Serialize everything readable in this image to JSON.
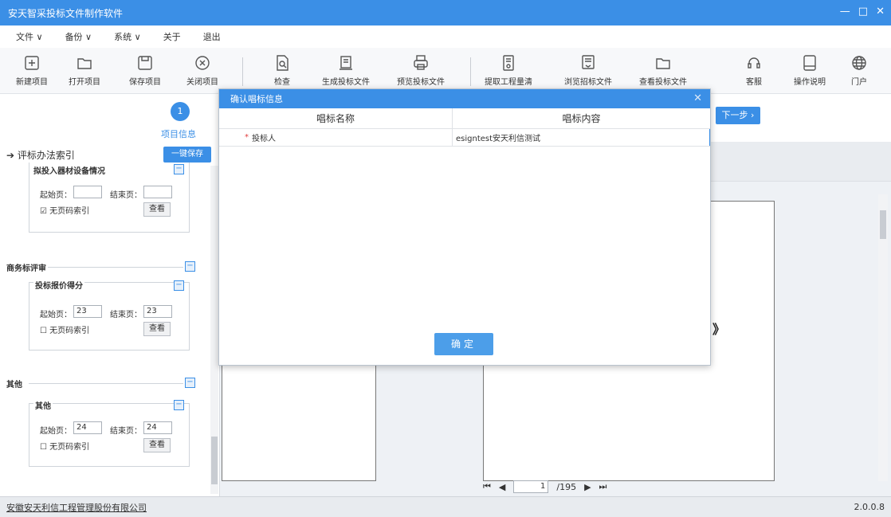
{
  "window": {
    "title": "安天智采投标文件制作软件",
    "controls": [
      "—",
      "□",
      "✕"
    ]
  },
  "menu": [
    "文件 ∨",
    "备份 ∨",
    "系统 ∨",
    "关于",
    "退出"
  ],
  "toolbar": {
    "items": [
      {
        "label": "新建项目",
        "icon": "add-icon"
      },
      {
        "label": "打开项目",
        "icon": "folder-icon"
      },
      {
        "label": "保存项目",
        "icon": "save-icon"
      },
      {
        "label": "关闭项目",
        "icon": "close-circle-icon"
      },
      {
        "label": "检查",
        "icon": "doc-search-icon"
      },
      {
        "label": "生成投标文件",
        "icon": "printer-doc-icon"
      },
      {
        "label": "预览投标文件",
        "icon": "printer-icon"
      },
      {
        "label": "提取工程量清单",
        "icon": "doc-gear-icon"
      },
      {
        "label": "浏览招标文件",
        "icon": "doc-layers-icon"
      },
      {
        "label": "查看投标文件",
        "icon": "folder-open-icon"
      },
      {
        "label": "客服",
        "icon": "headset-icon"
      },
      {
        "label": "操作说明",
        "icon": "manual-icon"
      },
      {
        "label": "门户",
        "icon": "globe-icon"
      }
    ]
  },
  "steps": {
    "current_number": "1",
    "current_label": "项目信息",
    "next_label": "下一步 ›"
  },
  "left_panel": {
    "title": "评标办法索引",
    "save_label": "一键保存",
    "sections": [
      {
        "name": "拟投入器材设备情况",
        "start_label": "起始页：",
        "end_label": "结束页：",
        "start": "",
        "end": "",
        "no_index_label": "无页码索引",
        "no_index_checked": true,
        "view_label": "查看"
      },
      {
        "group": "商务标评审",
        "name": "投标报价得分",
        "start_label": "起始页：",
        "end_label": "结束页：",
        "start": "23",
        "end": "23",
        "no_index_label": "无页码索引",
        "no_index_checked": false,
        "view_label": "查看"
      },
      {
        "group": "其他",
        "name": "其他",
        "start_label": "起始页：",
        "end_label": "结束页：",
        "start": "24",
        "end": "24",
        "no_index_label": "无页码索引",
        "no_index_checked": false,
        "view_label": "查看"
      }
    ]
  },
  "pager": {
    "current": "1",
    "total": "/195"
  },
  "status": {
    "company": "安徽安天利信工程管理股份有限公司",
    "version": "2.0.0.8"
  },
  "dialog": {
    "title": "确认唱标信息",
    "close": "✕",
    "columns": [
      "唱标名称",
      "唱标内容"
    ],
    "rows": [
      {
        "name": "投标人",
        "value": "esigntest安天利信测试",
        "required_mark": "*"
      }
    ],
    "ok_label": "确定"
  }
}
